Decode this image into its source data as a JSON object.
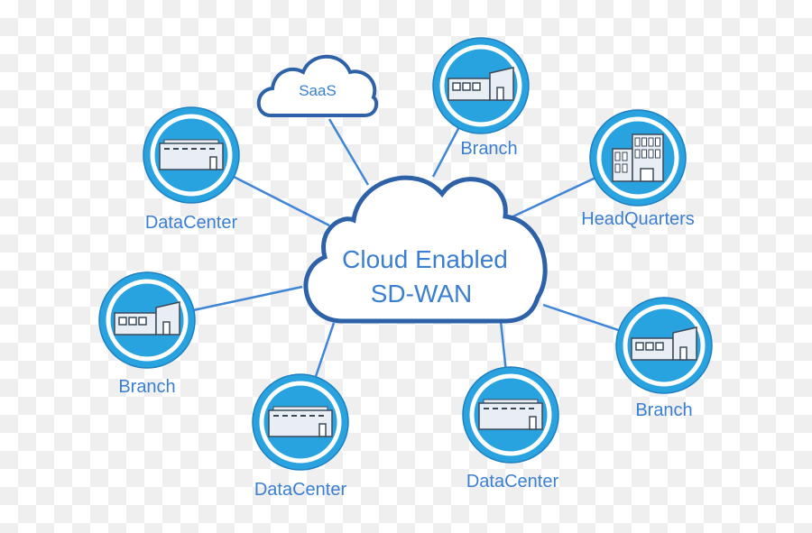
{
  "hub": {
    "line1": "Cloud Enabled",
    "line2": "SD-WAN"
  },
  "saas": {
    "label": "SaaS"
  },
  "nodes": [
    {
      "label": "Branch",
      "icon": "branch-building-icon"
    },
    {
      "label": "HeadQuarters",
      "icon": "headquarters-building-icon"
    },
    {
      "label": "Branch",
      "icon": "branch-building-icon"
    },
    {
      "label": "DataCenter",
      "icon": "datacenter-building-icon"
    },
    {
      "label": "DataCenter",
      "icon": "datacenter-building-icon"
    },
    {
      "label": "Branch",
      "icon": "branch-building-icon"
    },
    {
      "label": "DataCenter",
      "icon": "datacenter-building-icon"
    }
  ],
  "colors": {
    "accent": "#29a3e0",
    "text": "#3a7fd2",
    "line": "#3f86d6",
    "outline": "#2d62a8"
  }
}
